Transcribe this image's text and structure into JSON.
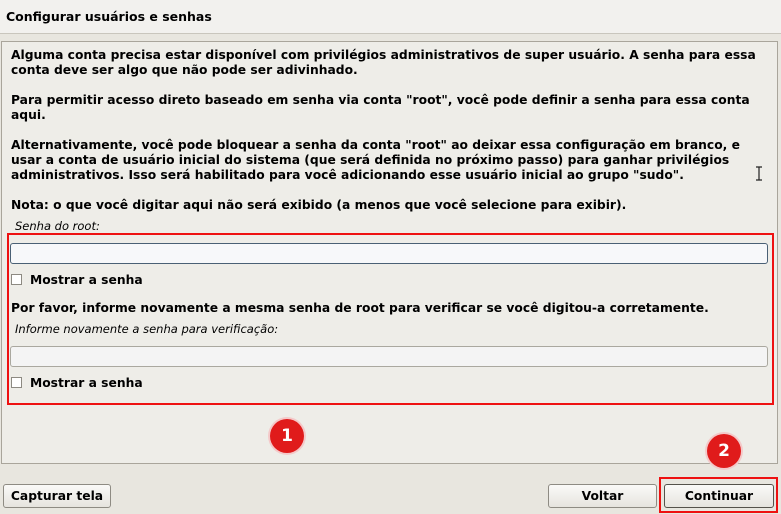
{
  "window": {
    "title": "Configurar usuários e senhas"
  },
  "intro": {
    "p1": "Alguma conta precisa estar disponível com privilégios administrativos de super usuário. A senha para essa conta deve ser algo que não pode ser adivinhado.",
    "p2": "Para permitir acesso direto baseado em senha via conta \"root\", você pode definir a senha para essa conta aqui.",
    "p3": "Alternativamente, você pode bloquear a senha da conta \"root\" ao deixar essa configuração em branco, e usar a conta de usuário inicial do sistema (que será definida no próximo passo) para ganhar privilégios administrativos. Isso será habilitado para você adicionando esse usuário inicial ao grupo \"sudo\".",
    "p4": "Nota: o que você digitar aqui não será exibido (a menos que você selecione para exibir)."
  },
  "root_password": {
    "label": "Senha do root:",
    "value": "",
    "show_label": "Mostrar a senha",
    "show_checked": false
  },
  "verify": {
    "instruction": "Por favor, informe novamente a mesma senha de root para verificar se você digitou-a corretamente.",
    "label": "Informe novamente a senha para verificação:",
    "value": "",
    "show_label": "Mostrar a senha",
    "show_checked": false
  },
  "annotations": {
    "badge1": "1",
    "badge2": "2",
    "color": "#e01b1b"
  },
  "buttons": {
    "screenshot": "Capturar tela",
    "back": "Voltar",
    "continue": "Continuar"
  }
}
